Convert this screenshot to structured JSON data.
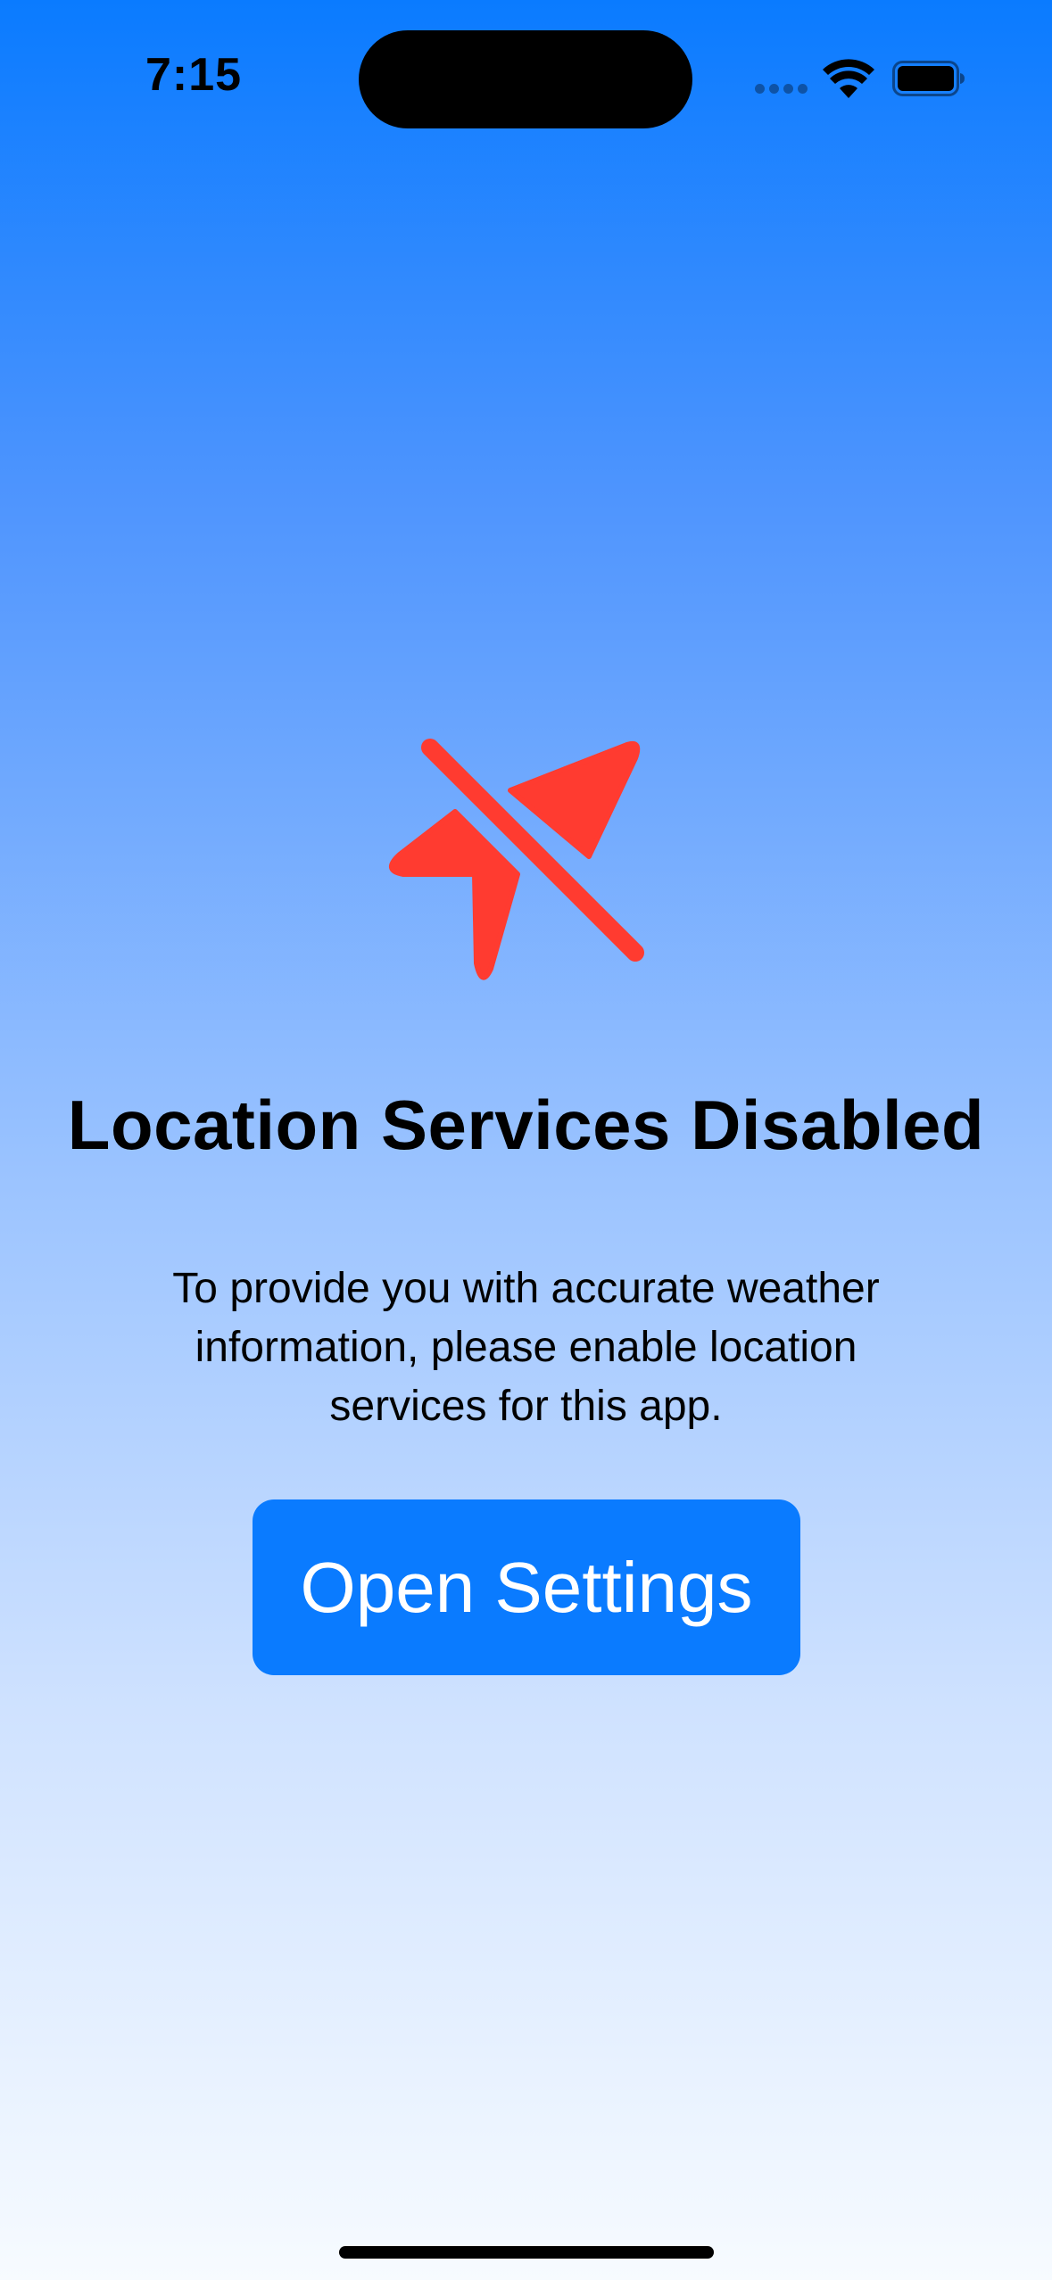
{
  "status_bar": {
    "time": "7:15"
  },
  "icons": {
    "status": [
      "cellular-icon",
      "wifi-icon",
      "battery-icon"
    ],
    "hero": "location-slash-icon"
  },
  "colors": {
    "accent": "#0a7bff",
    "icon_red": "#ff3b30",
    "gradient_top": "#0a7bff",
    "gradient_bottom": "#f7fbff"
  },
  "main": {
    "title": "Location Services Disabled",
    "description": "To provide you with accurate weather information, please enable location services for this app.",
    "button_label": "Open Settings"
  }
}
